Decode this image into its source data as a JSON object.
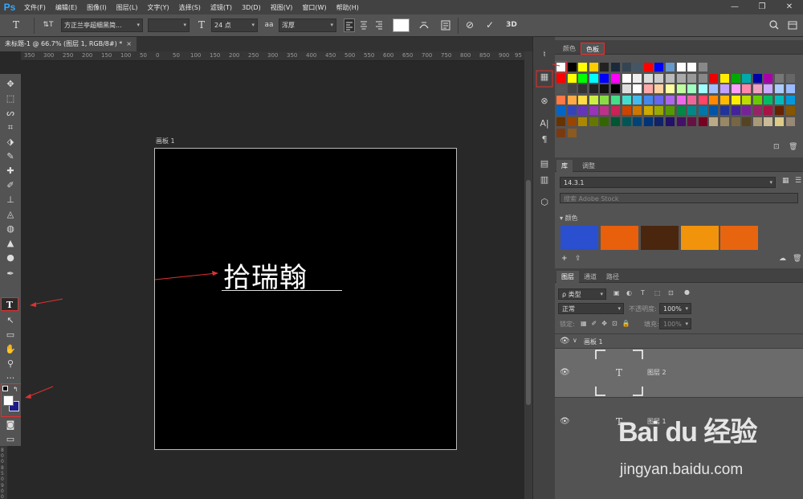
{
  "app": {
    "logo": "Ps"
  },
  "menu": [
    "文件(F)",
    "编辑(E)",
    "图像(I)",
    "图层(L)",
    "文字(Y)",
    "选择(S)",
    "滤镜(T)",
    "3D(D)",
    "视图(V)",
    "窗口(W)",
    "帮助(H)"
  ],
  "window_controls": {
    "minimize": "—",
    "restore": "❐",
    "close": "✕"
  },
  "options": {
    "tool_icon": "T",
    "orient_icon": "⇅T",
    "font_family": "方正兰亭超细黑简...",
    "font_style": "",
    "size_icon": "T",
    "font_size": "24 点",
    "aa_icon": "aa",
    "anti_alias": "浑厚",
    "cancel_icon": "⊘",
    "commit_icon": "✓",
    "threed_label": "3D",
    "text_color": "#ffffff"
  },
  "document": {
    "tab_title": "未标题-1 @ 66.7% (图层 1, RGB/8#) *",
    "close": "×",
    "artboard_label": "画板 1",
    "text_content": "拾瑞翰"
  },
  "ruler_ticks": [
    "350",
    "300",
    "250",
    "200",
    "150",
    "100",
    "50",
    "0",
    "50",
    "100",
    "150",
    "200",
    "250",
    "300",
    "350",
    "400",
    "450",
    "500",
    "550",
    "600",
    "650",
    "700",
    "750",
    "800",
    "850",
    "900",
    "95"
  ],
  "vertical_ruler_ticks": [
    "8",
    "0",
    "0",
    "8",
    "5",
    "0",
    "9",
    "0",
    "0"
  ],
  "tools": [
    "✥",
    "⬚",
    "ᔕ",
    "⌗",
    "⬗",
    "✎",
    "✚",
    "✐",
    "⊥",
    "◬",
    "◍",
    "▲",
    "●",
    "✒",
    "T",
    "↖",
    "▭",
    "✋",
    "⚲",
    "···"
  ],
  "toolbar_bottom": [
    "◙",
    "▭"
  ],
  "swap_icon": "↰",
  "right_icons": [
    "♮",
    "▦",
    "⊗",
    "A|",
    "¶",
    "▤",
    "▥",
    "⬡"
  ],
  "swatches_panel": {
    "tabs": [
      "颜色",
      "色板"
    ],
    "active_tab": "色板",
    "rows": [
      [
        "#ffffff",
        "#000000",
        "#ffff00",
        "#ffcc00",
        "#222222",
        "#1a2a3a",
        "#334455",
        "#445566",
        "#ff0000",
        "#0000ff",
        "#6699cc",
        "#ffffff",
        "#ffffff",
        "#888888"
      ],
      [
        "#ff0000",
        "#ffff00",
        "#00ff00",
        "#00ffff",
        "#0000ff",
        "#ff00ff",
        "#ffffff",
        "#eeeeee",
        "#dddddd",
        "#cccccc",
        "#bbbbbb",
        "#aaaaaa",
        "#999999",
        "#888888",
        "#ee0000",
        "#ffee00",
        "#00aa00",
        "#00aaaa",
        "#0000aa",
        "#aa00aa",
        "#777777",
        "#666666"
      ],
      [
        "#555555",
        "#444444",
        "#333333",
        "#222222",
        "#111111",
        "#000000",
        "#dddddd",
        "#ffffff",
        "#ffaaaa",
        "#ffd0a0",
        "#ffffa0",
        "#c0ffa0",
        "#a0ffc0",
        "#a0ffff",
        "#a0c0ff",
        "#c0a0ff",
        "#ffa0ff",
        "#ff88aa",
        "#f0a0c0",
        "#ccaaff",
        "#aaccff",
        "#99bbff"
      ],
      [
        "#ff7744",
        "#ffaa44",
        "#ffdd44",
        "#ccee44",
        "#88dd44",
        "#44dd88",
        "#44ddcc",
        "#44bbee",
        "#4488ee",
        "#6666ee",
        "#aa66ee",
        "#ee66ee",
        "#ee6699",
        "#ff4466",
        "#ff8800",
        "#ffbb00",
        "#ffee00",
        "#bbdd00",
        "#66cc00",
        "#00bb66",
        "#00bbbb",
        "#0099dd"
      ],
      [
        "#0066cc",
        "#3344bb",
        "#6633bb",
        "#9933bb",
        "#bb3388",
        "#cc2255",
        "#cc4400",
        "#cc7700",
        "#ccaa00",
        "#99aa00",
        "#559900",
        "#008844",
        "#008888",
        "#0077aa",
        "#0055aa",
        "#223399",
        "#442299",
        "#772299",
        "#992266",
        "#aa1144",
        "#662200",
        "#885500"
      ],
      [
        "#663300",
        "#994400",
        "#aa8800",
        "#667700",
        "#336600",
        "#005533",
        "#005555",
        "#004477",
        "#003377",
        "#112266",
        "#221166",
        "#441166",
        "#661144",
        "#770022",
        "#bbaa88",
        "#998866",
        "#776644",
        "#554422",
        "#aa9977",
        "#ccbb99",
        "#ddcc88",
        "#998877"
      ],
      [
        "#7a3a10",
        "#8a5a20"
      ]
    ]
  },
  "library_panel": {
    "tabs": [
      "库",
      "调整"
    ],
    "library_name": "14.3.1",
    "search_placeholder": "搜索 Adobe Stock",
    "group_name": "颜色",
    "colors": [
      "#2a4fcf",
      "#e85f0c",
      "#4a260e",
      "#f2930c",
      "#e8650f"
    ]
  },
  "layers_panel": {
    "tabs": [
      "图层",
      "通道",
      "路径"
    ],
    "filter_label": "ρ 类型",
    "blend_mode": "正常",
    "opacity_label": "不透明度:",
    "opacity_value": "100%",
    "lock_label": "锁定:",
    "fill_label": "填充:",
    "fill_value": "100%",
    "artboard_group": "画板 1",
    "layers": [
      {
        "name": "图层 2",
        "selected": true
      },
      {
        "name": "图层 1",
        "selected": false
      }
    ]
  },
  "watermark": {
    "logo": "Bai du 经验",
    "url": "jingyan.baidu.com"
  }
}
